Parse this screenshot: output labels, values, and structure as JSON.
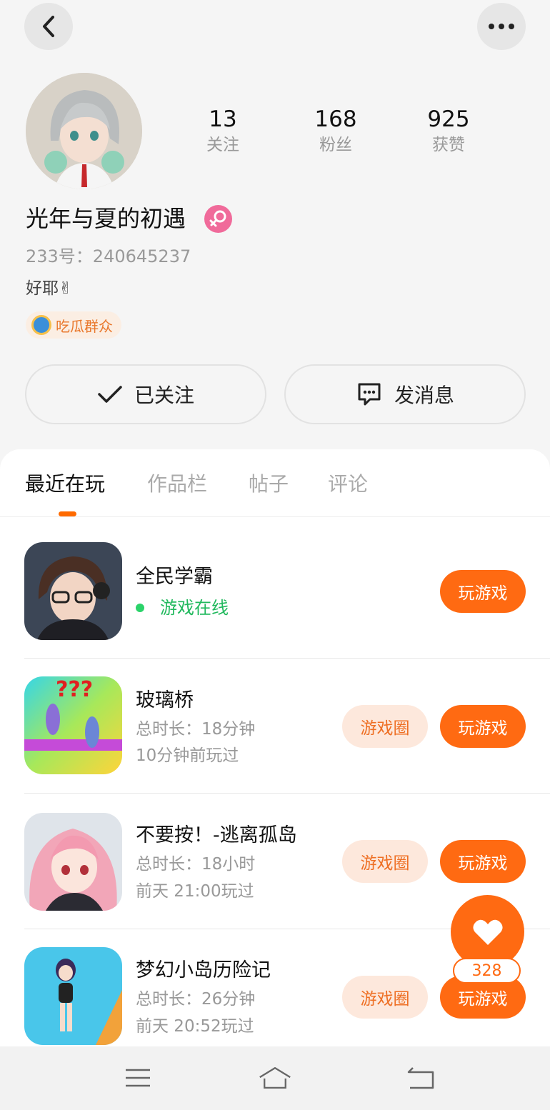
{
  "header": {
    "back_icon": "chevron-left-icon",
    "more_icon": "more-dots-icon"
  },
  "profile": {
    "username": "光年与夏的初遇",
    "gender_icon": "female-icon",
    "uid": "233号：240645237",
    "bio": "好耶✌",
    "badge": {
      "icon": "medal-icon",
      "label": "吃瓜群众"
    },
    "stats": [
      {
        "value": "13",
        "label": "关注"
      },
      {
        "value": "168",
        "label": "粉丝"
      },
      {
        "value": "925",
        "label": "获赞"
      }
    ]
  },
  "actions": {
    "follow_label": "已关注",
    "message_label": "发消息"
  },
  "tabs": [
    {
      "label": "最近在玩",
      "active": true
    },
    {
      "label": "作品栏",
      "active": false
    },
    {
      "label": "帖子",
      "active": false
    },
    {
      "label": "评论",
      "active": false
    }
  ],
  "games": [
    {
      "title": "全民学霸",
      "status": "游戏在线",
      "circle_label": "",
      "play_label": "玩游戏"
    },
    {
      "title": "玻璃桥",
      "duration": "总时长：18分钟",
      "last_played": "10分钟前玩过",
      "circle_label": "游戏圈",
      "play_label": "玩游戏"
    },
    {
      "title": "不要按！-逃离孤岛",
      "duration": "总时长：18小时",
      "last_played": "前天 21:00玩过",
      "circle_label": "游戏圈",
      "play_label": "玩游戏"
    },
    {
      "title": "梦幻小岛历险记",
      "duration": "总时长：26分钟",
      "last_played": "前天 20:52玩过",
      "circle_label": "游戏圈",
      "play_label": "玩游戏"
    }
  ],
  "like": {
    "icon": "heart-icon",
    "count": "328"
  },
  "navbar": {
    "menu_icon": "menu-icon",
    "home_icon": "home-icon",
    "back_icon": "back-arrow-icon"
  },
  "colors": {
    "accent": "#ff6a12",
    "online": "#22b95e",
    "circle_bg": "#fde8dc"
  }
}
